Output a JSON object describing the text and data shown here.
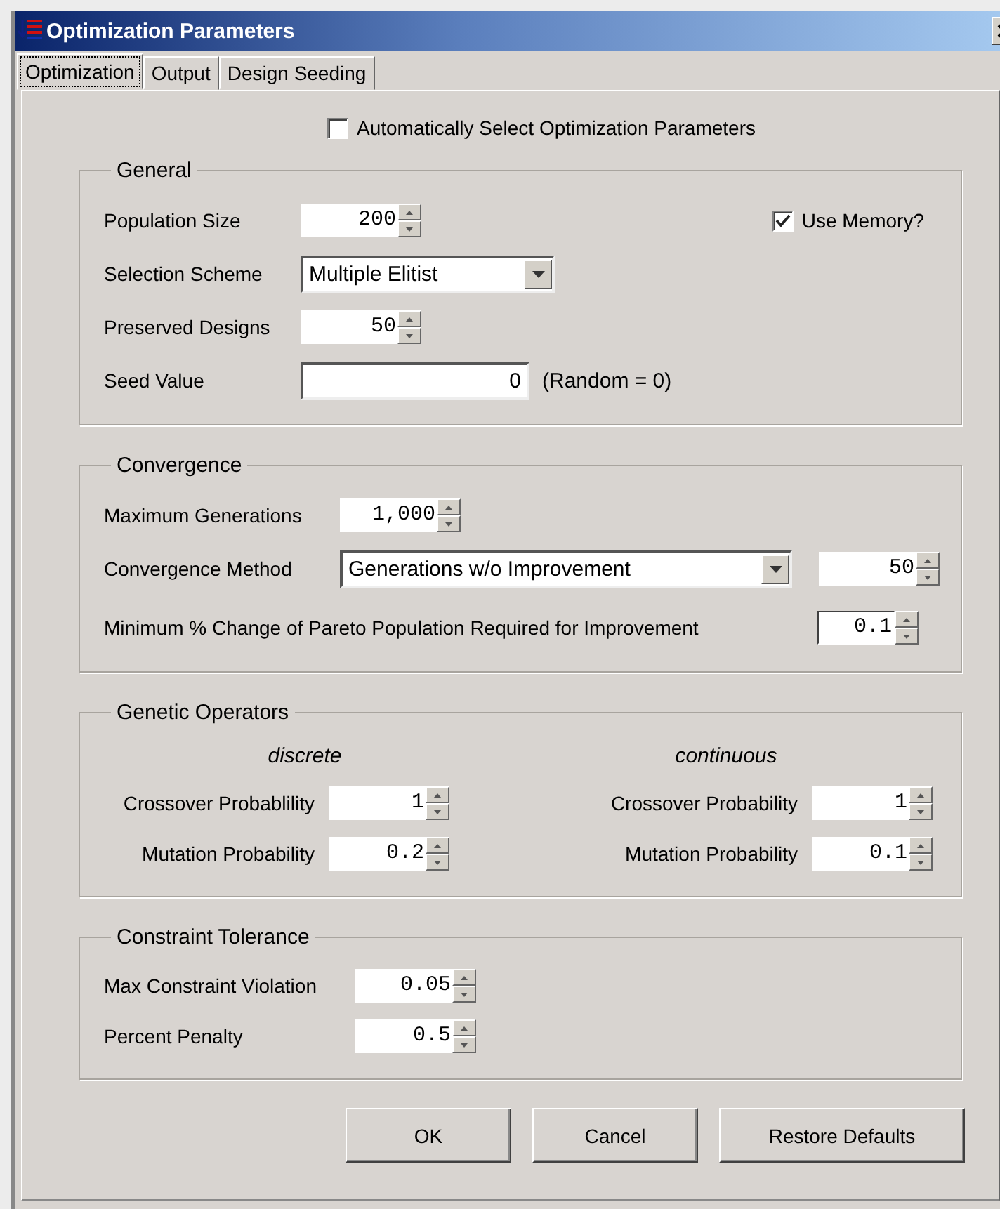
{
  "window": {
    "title": "Optimization Parameters"
  },
  "tabs": [
    {
      "label": "Optimization",
      "selected": true
    },
    {
      "label": "Output",
      "selected": false
    },
    {
      "label": "Design Seeding",
      "selected": false
    }
  ],
  "auto_select": {
    "label": "Automatically Select Optimization Parameters",
    "checked": false
  },
  "groups": [
    {
      "kind": "general",
      "title": "General",
      "rows": [
        {
          "label": "Population Size",
          "controls": [
            {
              "kind": "spinner",
              "value": "200"
            }
          ],
          "extra": {
            "kind": "checkbox",
            "label": "Use Memory?",
            "checked": true
          }
        },
        {
          "label": "Selection Scheme",
          "controls": [
            {
              "kind": "combo",
              "value": "Multiple Elitist"
            }
          ]
        },
        {
          "label": "Preserved Designs",
          "controls": [
            {
              "kind": "spinner",
              "value": "50"
            }
          ]
        },
        {
          "label": "Seed Value",
          "controls": [
            {
              "kind": "text",
              "value": "0"
            },
            {
              "kind": "note",
              "value": "(Random = 0)"
            }
          ]
        }
      ]
    },
    {
      "kind": "convergence",
      "title": "Convergence",
      "rows": [
        {
          "label": "Maximum Generations",
          "controls": [
            {
              "kind": "spinner",
              "value": "1,000"
            }
          ]
        },
        {
          "label": "Convergence Method",
          "controls": [
            {
              "kind": "combo",
              "value": "Generations w/o Improvement"
            },
            {
              "kind": "spinner",
              "value": "50"
            }
          ]
        },
        {
          "label": "Minimum % Change of Pareto Population Required for Improvement",
          "controls": [
            {
              "kind": "spinner",
              "value": "0.1",
              "focused": true
            }
          ]
        }
      ]
    },
    {
      "kind": "columns",
      "title": "Genetic Operators",
      "columns": [
        {
          "heading": "discrete",
          "rows": [
            {
              "label": "Crossover Probablility",
              "value": "1"
            },
            {
              "label": "Mutation Probability",
              "value": "0.2"
            }
          ]
        },
        {
          "heading": "continuous",
          "rows": [
            {
              "label": "Crossover Probability",
              "value": "1"
            },
            {
              "label": "Mutation Probability",
              "value": "0.1"
            }
          ]
        }
      ]
    },
    {
      "kind": "constraint",
      "title": "Constraint Tolerance",
      "rows": [
        {
          "label": "Max Constraint Violation",
          "controls": [
            {
              "kind": "spinner",
              "value": "0.05"
            }
          ]
        },
        {
          "label": "Percent Penalty",
          "controls": [
            {
              "kind": "spinner",
              "value": "0.5"
            }
          ]
        }
      ]
    }
  ],
  "buttons": [
    "OK",
    "Cancel",
    "Restore Defaults"
  ]
}
